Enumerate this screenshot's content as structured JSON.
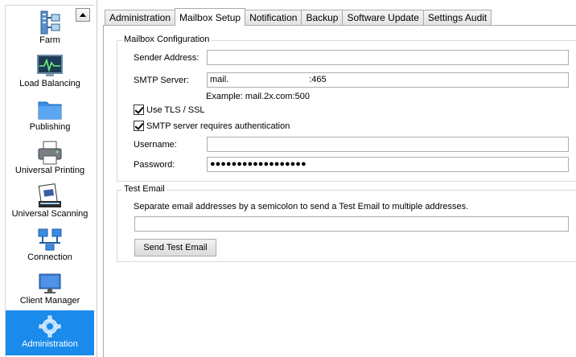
{
  "sidebar": {
    "collapse_icon": "triangle-up-icon",
    "items": [
      {
        "label": "Farm",
        "icon": "farm-icon"
      },
      {
        "label": "Load Balancing",
        "icon": "load-balancing-icon"
      },
      {
        "label": "Publishing",
        "icon": "folder-icon"
      },
      {
        "label": "Universal Printing",
        "icon": "printer-icon"
      },
      {
        "label": "Universal Scanning",
        "icon": "scanner-icon"
      },
      {
        "label": "Connection",
        "icon": "network-icon"
      },
      {
        "label": "Client Manager",
        "icon": "monitor-icon"
      },
      {
        "label": "Administration",
        "icon": "gear-icon"
      }
    ],
    "active_index": 7,
    "accent_color": "#1a8bea"
  },
  "tabs": [
    {
      "label": "Administration"
    },
    {
      "label": "Mailbox Setup"
    },
    {
      "label": "Notification"
    },
    {
      "label": "Backup"
    },
    {
      "label": "Software Update"
    },
    {
      "label": "Settings Audit"
    }
  ],
  "active_tab": 1,
  "mailbox": {
    "group_title": "Mailbox Configuration",
    "sender_label": "Sender Address:",
    "sender_value": "",
    "smtp_label": "SMTP Server:",
    "smtp_value_prefix": "mail.",
    "smtp_value_suffix": ":465",
    "example_text": "Example: mail.2x.com:500",
    "tls_label": "Use TLS / SSL",
    "auth_label": "SMTP server requires authentication",
    "username_label": "Username:",
    "username_value": "",
    "password_label": "Password:",
    "password_value": "●●●●●●●●●●●●●●●●●●"
  },
  "test_email": {
    "group_title": "Test Email",
    "instructions": "Separate email addresses by a semicolon to send a Test Email to multiple addresses.",
    "addresses_value": "",
    "send_button": "Send Test Email"
  }
}
